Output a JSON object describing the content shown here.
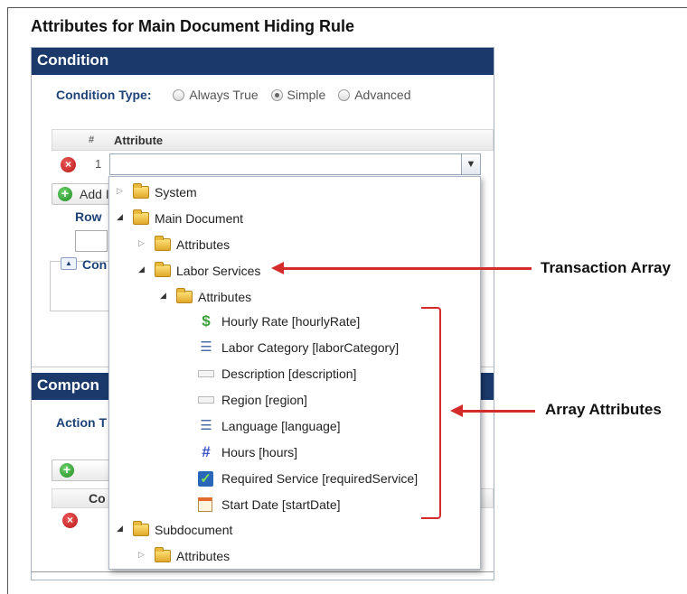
{
  "title": "Attributes for Main Document Hiding Rule",
  "condition": {
    "header": "Condition",
    "type_label": "Condition Type:",
    "options": [
      "Always True",
      "Simple",
      "Advanced"
    ],
    "selected": "Simple",
    "grid_headers": {
      "num": "#",
      "attribute": "Attribute"
    },
    "row_number": "1",
    "attribute_value": "",
    "add_label": "Add I",
    "row_label": "Row",
    "collapsible_label": "Con"
  },
  "component": {
    "header": "Compon",
    "action_label": "Action T",
    "grid_header": "Co"
  },
  "tree": {
    "system": "System",
    "main_document": "Main Document",
    "md_attributes": "Attributes",
    "labor_services": "Labor Services",
    "ls_attributes": "Attributes",
    "fields": [
      {
        "label": "Hourly Rate [hourlyRate]",
        "icon": "dollar-icon"
      },
      {
        "label": "Labor Category [laborCategory]",
        "icon": "list-icon"
      },
      {
        "label": "Description [description]",
        "icon": "text-field-icon"
      },
      {
        "label": "Region [region]",
        "icon": "text-field-icon"
      },
      {
        "label": "Language [language]",
        "icon": "list-icon"
      },
      {
        "label": "Hours [hours]",
        "icon": "hash-icon"
      },
      {
        "label": "Required Service [requiredService]",
        "icon": "checkbox-icon"
      },
      {
        "label": "Start Date [startDate]",
        "icon": "calendar-icon"
      }
    ],
    "subdocument": "Subdocument",
    "sd_attributes": "Attributes"
  },
  "annotations": {
    "transaction_array": "Transaction Array",
    "array_attributes": "Array Attributes"
  },
  "colors": {
    "header_bg": "#1b3a6b",
    "label_blue": "#1e4278",
    "annotation_red": "#d42b2b"
  }
}
